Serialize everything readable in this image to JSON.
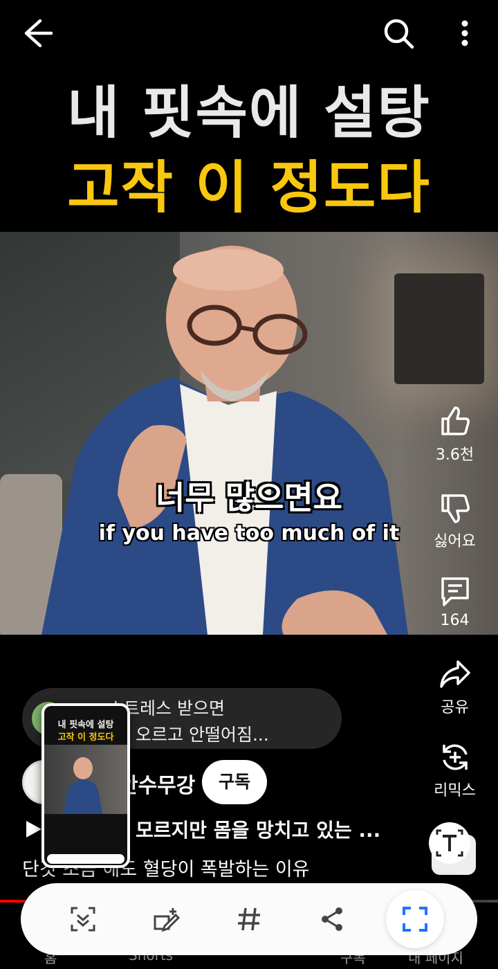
{
  "video": {
    "title_line1": "내 핏속에 설탕",
    "title_line2": "고작 이 정도다",
    "subtitle_korean": "너무 많으면요",
    "subtitle_english": "if you have too much of it"
  },
  "actions": {
    "like_count": "3.6천",
    "dislike_label": "싫어요",
    "comment_count": "164",
    "share_label": "공유",
    "remix_label": "리믹스"
  },
  "comment_preview": {
    "line1": "스트레스 받으면",
    "line2": "오르고 안떨어짐..."
  },
  "channel": {
    "name": "안수무강",
    "subscribe_label": "구독"
  },
  "playlist": {
    "title": "모르지만 몸을 망치고 있는 ..."
  },
  "description": "단것 조금 해도 혈당이 폭발하는 이유",
  "bottom_nav": {
    "home_label": "홈",
    "shorts_label": "Shorts",
    "subscriptions_label": "구독",
    "my_page_label": "내 페이지"
  },
  "thumbnail": {
    "line1": "내 핏속에 설탕",
    "line2": "고작 이 정도다"
  },
  "progress": {
    "played_fraction": 0.05
  },
  "colors": {
    "title_yellow": "#f9c80e",
    "progress_red": "#ff0000",
    "capture_accent": "#1e73ff"
  },
  "icons": {
    "back": "back-arrow-icon",
    "search": "search-icon",
    "more": "more-vertical-icon",
    "like": "thumbs-up-icon",
    "dislike": "thumbs-down-icon",
    "comment": "comment-icon",
    "share": "share-icon",
    "remix": "remix-icon",
    "text_capture": "text-extract-icon",
    "scroll_capture": "scroll-capture-icon",
    "draw": "draw-crop-icon",
    "tag": "hashtag-icon",
    "share_capture": "share-nodes-icon",
    "crop": "crop-frame-icon"
  }
}
